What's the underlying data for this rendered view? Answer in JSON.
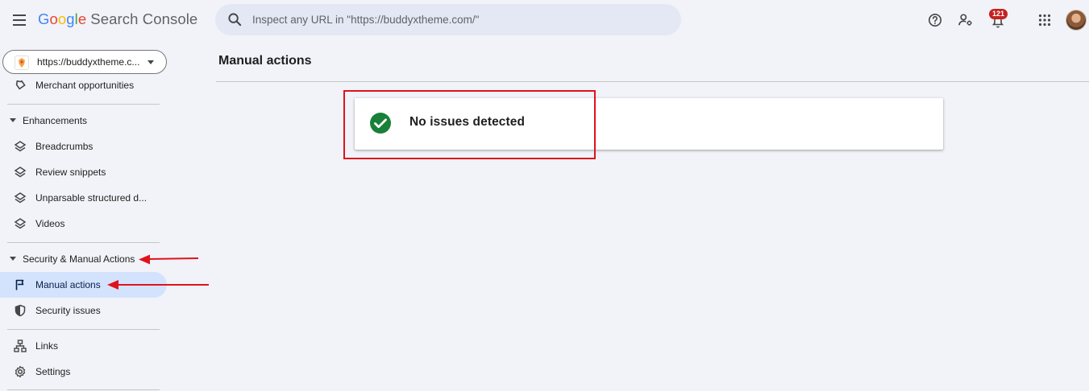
{
  "header": {
    "logo_letters": [
      "G",
      "o",
      "o",
      "g",
      "l",
      "e"
    ],
    "product_name": "Search Console",
    "search_placeholder": "Inspect any URL in \"https://buddyxtheme.com/\"",
    "notification_count": "121",
    "icons": [
      "menu-icon",
      "search-icon",
      "help-icon",
      "manage-users-icon",
      "notifications-icon",
      "apps-grid-icon",
      "avatar"
    ]
  },
  "sidebar": {
    "property_label": "https://buddyxtheme.c...",
    "top_item": "Merchant opportunities",
    "enhancements": {
      "label": "Enhancements",
      "items": [
        "Breadcrumbs",
        "Review snippets",
        "Unparsable structured d...",
        "Videos"
      ]
    },
    "security": {
      "label": "Security & Manual Actions",
      "items": [
        "Manual actions",
        "Security issues"
      ],
      "active": "Manual actions"
    },
    "bottom_items": [
      "Links",
      "Settings"
    ]
  },
  "main": {
    "title": "Manual actions",
    "status_text": "No issues detected"
  },
  "colors": {
    "accent_active_bg": "#d3e3fd",
    "success_green": "#188038",
    "annotation_red": "#e0121b",
    "badge_red": "#c5221f"
  }
}
